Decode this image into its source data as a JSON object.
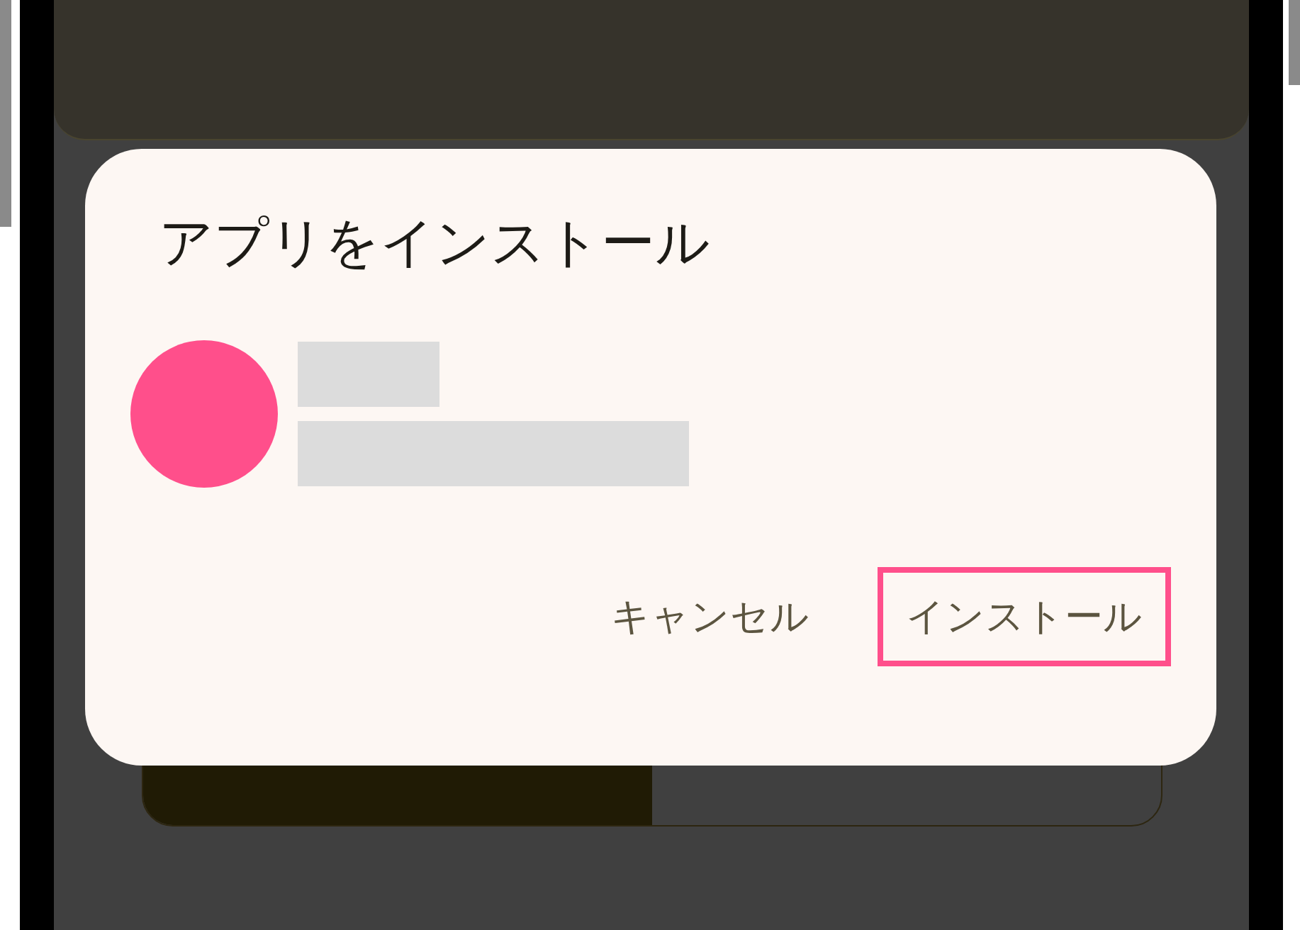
{
  "background": {
    "actions": [
      {
        "selected": true
      },
      {
        "selected": false
      }
    ]
  },
  "dialog": {
    "title": "アプリをインストール",
    "buttons": [
      {
        "label": "キャンセル",
        "highlighted": false
      },
      {
        "label": "インストール",
        "highlighted": true
      }
    ]
  }
}
